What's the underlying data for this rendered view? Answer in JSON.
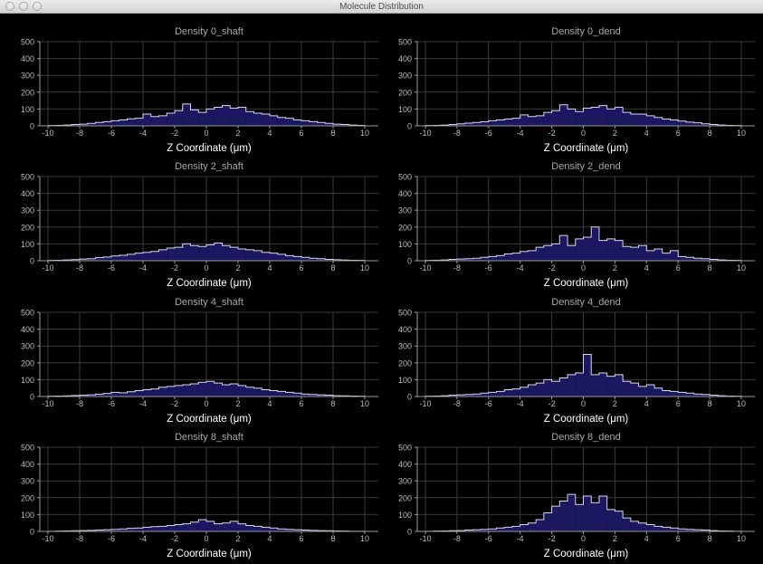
{
  "window": {
    "title": "Molecule Distribution"
  },
  "colors": {
    "background": "#000000",
    "grid": "#3a3a3a",
    "axis": "#9a9a9a",
    "tick_text": "#bdbdbd",
    "title_text": "#a8a8a8",
    "xlabel_text": "#ffffff",
    "bar_fill": "#1b1760",
    "bar_stroke": "#d8d8e8"
  },
  "chart_data": [
    {
      "type": "bar",
      "title": "Density 0_shaft",
      "xlabel": "Z Coordinate (μm)",
      "ylabel": "",
      "xlim": [
        -10,
        10
      ],
      "ylim": [
        0,
        500
      ],
      "xticks": [
        -10,
        -8,
        -6,
        -4,
        -2,
        0,
        2,
        4,
        6,
        8,
        10
      ],
      "yticks": [
        0,
        100,
        200,
        300,
        400,
        500
      ],
      "grid": true,
      "bin_width": 0.5,
      "x": [
        -10,
        -9.5,
        -9,
        -8.5,
        -8,
        -7.5,
        -7,
        -6.5,
        -6,
        -5.5,
        -5,
        -4.5,
        -4,
        -3.5,
        -3,
        -2.5,
        -2,
        -1.5,
        -1,
        -0.5,
        0,
        0.5,
        1,
        1.5,
        2,
        2.5,
        3,
        3.5,
        4,
        4.5,
        5,
        5.5,
        6,
        6.5,
        7,
        7.5,
        8,
        8.5,
        9,
        9.5
      ],
      "values": [
        2,
        3,
        5,
        8,
        10,
        15,
        20,
        25,
        30,
        35,
        42,
        45,
        70,
        55,
        60,
        75,
        90,
        130,
        95,
        80,
        100,
        110,
        120,
        105,
        110,
        85,
        75,
        70,
        60,
        50,
        45,
        35,
        30,
        25,
        20,
        15,
        10,
        8,
        5,
        3
      ]
    },
    {
      "type": "bar",
      "title": "Density 0_dend",
      "xlabel": "Z Coordinate (μm)",
      "ylabel": "",
      "xlim": [
        -10,
        10
      ],
      "ylim": [
        0,
        500
      ],
      "xticks": [
        -10,
        -8,
        -6,
        -4,
        -2,
        0,
        2,
        4,
        6,
        8,
        10
      ],
      "yticks": [
        0,
        100,
        200,
        300,
        400,
        500
      ],
      "grid": true,
      "bin_width": 0.5,
      "x": [
        -10,
        -9.5,
        -9,
        -8.5,
        -8,
        -7.5,
        -7,
        -6.5,
        -6,
        -5.5,
        -5,
        -4.5,
        -4,
        -3.5,
        -3,
        -2.5,
        -2,
        -1.5,
        -1,
        -0.5,
        0,
        0.5,
        1,
        1.5,
        2,
        2.5,
        3,
        3.5,
        4,
        4.5,
        5,
        5.5,
        6,
        6.5,
        7,
        7.5,
        8,
        8.5,
        9,
        9.5
      ],
      "values": [
        2,
        3,
        5,
        8,
        12,
        16,
        20,
        24,
        30,
        35,
        40,
        45,
        65,
        55,
        60,
        80,
        90,
        125,
        100,
        85,
        105,
        110,
        120,
        100,
        110,
        80,
        70,
        70,
        60,
        50,
        40,
        35,
        28,
        22,
        18,
        12,
        8,
        5,
        3,
        2
      ]
    },
    {
      "type": "bar",
      "title": "Density 2_shaft",
      "xlabel": "Z Coordinate (μm)",
      "ylabel": "",
      "xlim": [
        -10,
        10
      ],
      "ylim": [
        0,
        500
      ],
      "xticks": [
        -10,
        -8,
        -6,
        -4,
        -2,
        0,
        2,
        4,
        6,
        8,
        10
      ],
      "yticks": [
        0,
        100,
        200,
        300,
        400,
        500
      ],
      "grid": true,
      "bin_width": 0.5,
      "x": [
        -10,
        -9.5,
        -9,
        -8.5,
        -8,
        -7.5,
        -7,
        -6.5,
        -6,
        -5.5,
        -5,
        -4.5,
        -4,
        -3.5,
        -3,
        -2.5,
        -2,
        -1.5,
        -1,
        -0.5,
        0,
        0.5,
        1,
        1.5,
        2,
        2.5,
        3,
        3.5,
        4,
        4.5,
        5,
        5.5,
        6,
        6.5,
        7,
        7.5,
        8,
        8.5,
        9,
        9.5
      ],
      "values": [
        2,
        3,
        5,
        7,
        10,
        12,
        18,
        22,
        28,
        32,
        38,
        45,
        50,
        55,
        65,
        75,
        80,
        100,
        90,
        85,
        95,
        105,
        90,
        80,
        70,
        65,
        60,
        50,
        45,
        38,
        30,
        25,
        20,
        15,
        12,
        8,
        6,
        4,
        3,
        2
      ]
    },
    {
      "type": "bar",
      "title": "Density 2_dend",
      "xlabel": "Z Coordinate (μm)",
      "ylabel": "",
      "xlim": [
        -10,
        10
      ],
      "ylim": [
        0,
        500
      ],
      "xticks": [
        -10,
        -8,
        -6,
        -4,
        -2,
        0,
        2,
        4,
        6,
        8,
        10
      ],
      "yticks": [
        0,
        100,
        200,
        300,
        400,
        500
      ],
      "grid": true,
      "bin_width": 0.5,
      "x": [
        -10,
        -9.5,
        -9,
        -8.5,
        -8,
        -7.5,
        -7,
        -6.5,
        -6,
        -5.5,
        -5,
        -4.5,
        -4,
        -3.5,
        -3,
        -2.5,
        -2,
        -1.5,
        -1,
        -0.5,
        0,
        0.5,
        1,
        1.5,
        2,
        2.5,
        3,
        3.5,
        4,
        4.5,
        5,
        5.5,
        6,
        6.5,
        7,
        7.5,
        8,
        8.5,
        9,
        9.5
      ],
      "values": [
        2,
        3,
        5,
        8,
        10,
        12,
        15,
        20,
        25,
        30,
        40,
        45,
        55,
        60,
        80,
        90,
        100,
        150,
        90,
        130,
        140,
        200,
        120,
        130,
        120,
        85,
        80,
        90,
        60,
        70,
        45,
        60,
        25,
        20,
        15,
        12,
        8,
        5,
        3,
        2
      ]
    },
    {
      "type": "bar",
      "title": "Density 4_shaft",
      "xlabel": "Z Coordinate (μm)",
      "ylabel": "",
      "xlim": [
        -10,
        10
      ],
      "ylim": [
        0,
        500
      ],
      "xticks": [
        -10,
        -8,
        -6,
        -4,
        -2,
        0,
        2,
        4,
        6,
        8,
        10
      ],
      "yticks": [
        0,
        100,
        200,
        300,
        400,
        500
      ],
      "grid": true,
      "bin_width": 0.5,
      "x": [
        -10,
        -9.5,
        -9,
        -8.5,
        -8,
        -7.5,
        -7,
        -6.5,
        -6,
        -5.5,
        -5,
        -4.5,
        -4,
        -3.5,
        -3,
        -2.5,
        -2,
        -1.5,
        -1,
        -0.5,
        0,
        0.5,
        1,
        1.5,
        2,
        2.5,
        3,
        3.5,
        4,
        4.5,
        5,
        5.5,
        6,
        6.5,
        7,
        7.5,
        8,
        8.5,
        9,
        9.5
      ],
      "values": [
        2,
        3,
        4,
        6,
        8,
        10,
        14,
        18,
        25,
        22,
        28,
        35,
        40,
        45,
        55,
        60,
        65,
        70,
        75,
        85,
        90,
        80,
        70,
        75,
        65,
        55,
        50,
        40,
        35,
        30,
        25,
        20,
        15,
        12,
        10,
        8,
        5,
        4,
        3,
        2
      ]
    },
    {
      "type": "bar",
      "title": "Density 4_dend",
      "xlabel": "Z Coordinate (μm)",
      "ylabel": "",
      "xlim": [
        -10,
        10
      ],
      "ylim": [
        0,
        500
      ],
      "xticks": [
        -10,
        -8,
        -6,
        -4,
        -2,
        0,
        2,
        4,
        6,
        8,
        10
      ],
      "yticks": [
        0,
        100,
        200,
        300,
        400,
        500
      ],
      "grid": true,
      "bin_width": 0.5,
      "x": [
        -10,
        -9.5,
        -9,
        -8.5,
        -8,
        -7.5,
        -7,
        -6.5,
        -6,
        -5.5,
        -5,
        -4.5,
        -4,
        -3.5,
        -3,
        -2.5,
        -2,
        -1.5,
        -1,
        -0.5,
        0,
        0.5,
        1,
        1.5,
        2,
        2.5,
        3,
        3.5,
        4,
        4.5,
        5,
        5.5,
        6,
        6.5,
        7,
        7.5,
        8,
        8.5,
        9,
        9.5
      ],
      "values": [
        2,
        3,
        5,
        8,
        10,
        12,
        15,
        20,
        25,
        30,
        40,
        45,
        55,
        70,
        80,
        100,
        90,
        110,
        130,
        140,
        250,
        130,
        140,
        120,
        130,
        90,
        80,
        60,
        70,
        50,
        35,
        30,
        25,
        20,
        15,
        12,
        8,
        5,
        3,
        2
      ]
    },
    {
      "type": "bar",
      "title": "Density 8_shaft",
      "xlabel": "Z Coordinate (μm)",
      "ylabel": "",
      "xlim": [
        -10,
        10
      ],
      "ylim": [
        0,
        500
      ],
      "xticks": [
        -10,
        -8,
        -6,
        -4,
        -2,
        0,
        2,
        4,
        6,
        8,
        10
      ],
      "yticks": [
        0,
        100,
        200,
        300,
        400,
        500
      ],
      "grid": true,
      "bin_width": 0.5,
      "x": [
        -10,
        -9.5,
        -9,
        -8.5,
        -8,
        -7.5,
        -7,
        -6.5,
        -6,
        -5.5,
        -5,
        -4.5,
        -4,
        -3.5,
        -3,
        -2.5,
        -2,
        -1.5,
        -1,
        -0.5,
        0,
        0.5,
        1,
        1.5,
        2,
        2.5,
        3,
        3.5,
        4,
        4.5,
        5,
        5.5,
        6,
        6.5,
        7,
        7.5,
        8,
        8.5,
        9,
        9.5
      ],
      "values": [
        1,
        2,
        3,
        4,
        5,
        6,
        8,
        10,
        12,
        15,
        18,
        20,
        25,
        28,
        30,
        35,
        40,
        45,
        55,
        70,
        60,
        45,
        50,
        60,
        45,
        35,
        30,
        25,
        20,
        15,
        12,
        10,
        8,
        6,
        5,
        4,
        3,
        2,
        1,
        1
      ]
    },
    {
      "type": "bar",
      "title": "Density 8_dend",
      "xlabel": "Z Coordinate (μm)",
      "ylabel": "",
      "xlim": [
        -10,
        10
      ],
      "ylim": [
        0,
        500
      ],
      "xticks": [
        -10,
        -8,
        -6,
        -4,
        -2,
        0,
        2,
        4,
        6,
        8,
        10
      ],
      "yticks": [
        0,
        100,
        200,
        300,
        400,
        500
      ],
      "grid": true,
      "bin_width": 0.5,
      "x": [
        -10,
        -9.5,
        -9,
        -8.5,
        -8,
        -7.5,
        -7,
        -6.5,
        -6,
        -5.5,
        -5,
        -4.5,
        -4,
        -3.5,
        -3,
        -2.5,
        -2,
        -1.5,
        -1,
        -0.5,
        0,
        0.5,
        1,
        1.5,
        2,
        2.5,
        3,
        3.5,
        4,
        4.5,
        5,
        5.5,
        6,
        6.5,
        7,
        7.5,
        8,
        8.5,
        9,
        9.5
      ],
      "values": [
        1,
        2,
        3,
        4,
        5,
        8,
        10,
        12,
        15,
        20,
        25,
        30,
        40,
        50,
        70,
        110,
        150,
        180,
        220,
        160,
        210,
        170,
        210,
        130,
        120,
        80,
        60,
        50,
        40,
        30,
        25,
        20,
        15,
        12,
        10,
        8,
        5,
        3,
        2,
        1
      ]
    }
  ]
}
